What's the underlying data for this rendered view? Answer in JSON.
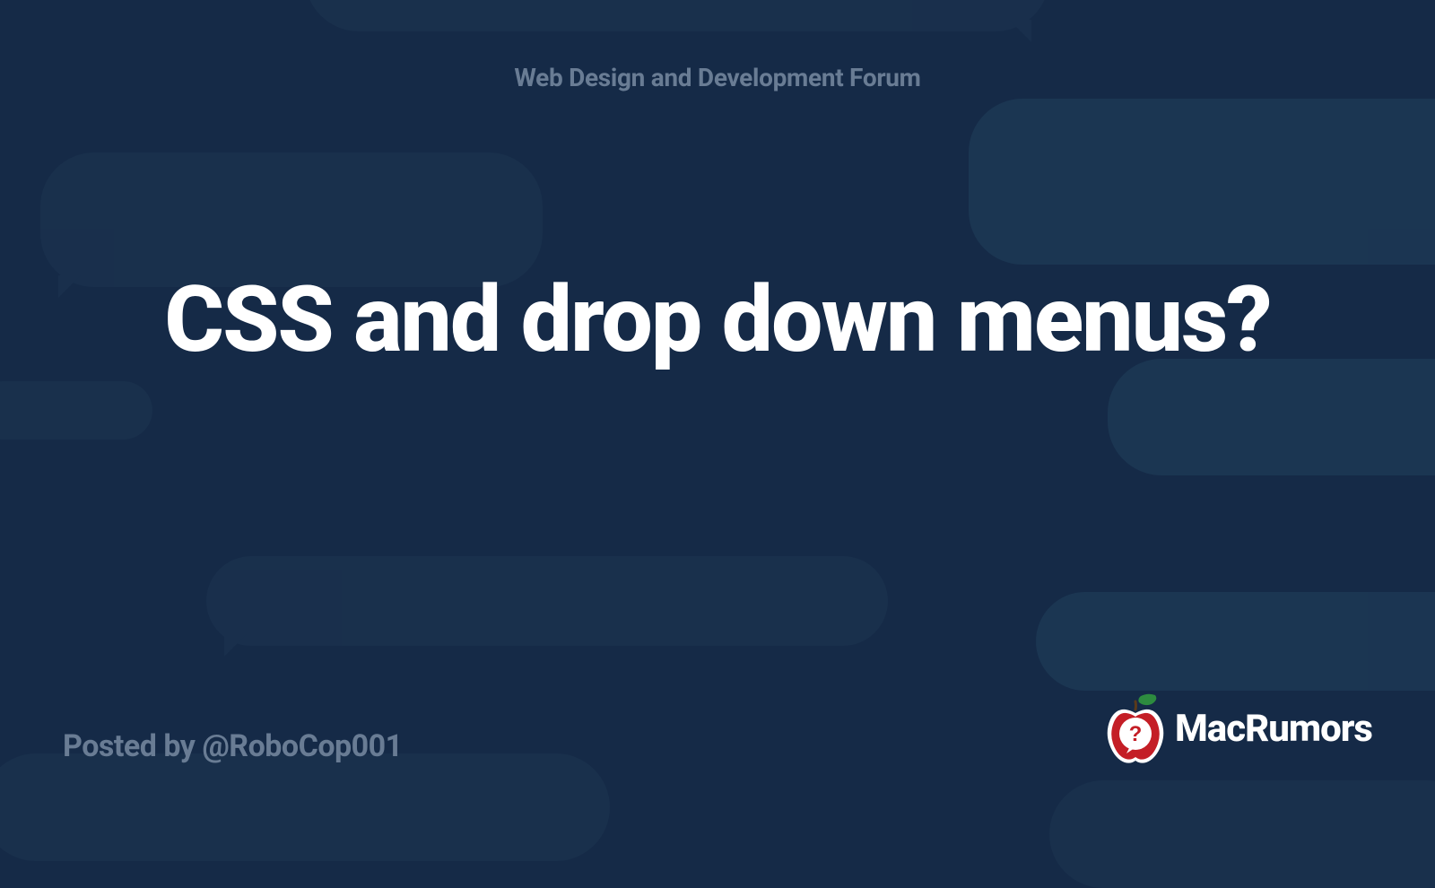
{
  "forum_name": "Web Design and Development Forum",
  "thread_title": "CSS and drop down menus?",
  "posted_by_prefix": "Posted by ",
  "posted_by_user": "@RoboCop001",
  "brand_name": "MacRumors",
  "colors": {
    "background": "#152a47",
    "bubble_dark": "#1d3552",
    "bubble_light": "#22415e",
    "muted_text": "#697c94",
    "title_text": "#ffffff"
  }
}
